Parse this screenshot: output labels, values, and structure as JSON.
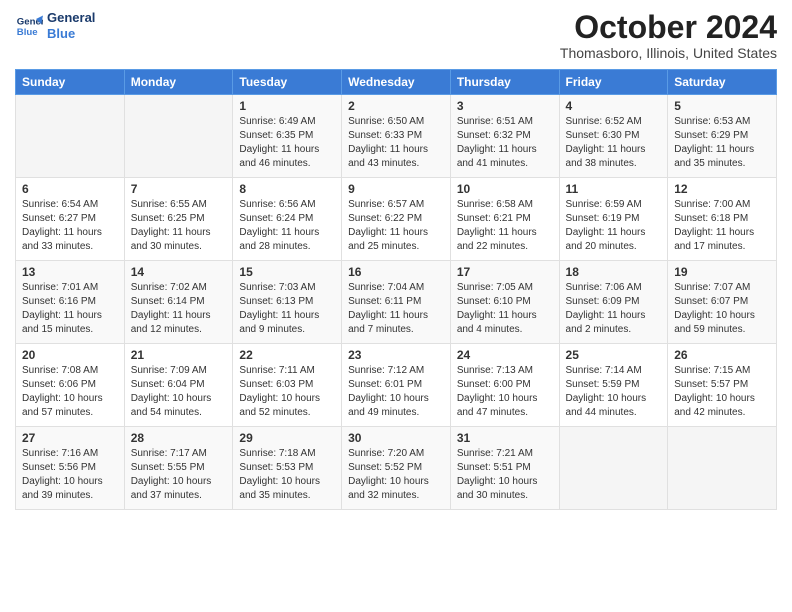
{
  "header": {
    "logo_line1": "General",
    "logo_line2": "Blue",
    "title": "October 2024",
    "location": "Thomasboro, Illinois, United States"
  },
  "days_of_week": [
    "Sunday",
    "Monday",
    "Tuesday",
    "Wednesday",
    "Thursday",
    "Friday",
    "Saturday"
  ],
  "weeks": [
    [
      {
        "day": "",
        "content": ""
      },
      {
        "day": "",
        "content": ""
      },
      {
        "day": "1",
        "content": "Sunrise: 6:49 AM\nSunset: 6:35 PM\nDaylight: 11 hours and 46 minutes."
      },
      {
        "day": "2",
        "content": "Sunrise: 6:50 AM\nSunset: 6:33 PM\nDaylight: 11 hours and 43 minutes."
      },
      {
        "day": "3",
        "content": "Sunrise: 6:51 AM\nSunset: 6:32 PM\nDaylight: 11 hours and 41 minutes."
      },
      {
        "day": "4",
        "content": "Sunrise: 6:52 AM\nSunset: 6:30 PM\nDaylight: 11 hours and 38 minutes."
      },
      {
        "day": "5",
        "content": "Sunrise: 6:53 AM\nSunset: 6:29 PM\nDaylight: 11 hours and 35 minutes."
      }
    ],
    [
      {
        "day": "6",
        "content": "Sunrise: 6:54 AM\nSunset: 6:27 PM\nDaylight: 11 hours and 33 minutes."
      },
      {
        "day": "7",
        "content": "Sunrise: 6:55 AM\nSunset: 6:25 PM\nDaylight: 11 hours and 30 minutes."
      },
      {
        "day": "8",
        "content": "Sunrise: 6:56 AM\nSunset: 6:24 PM\nDaylight: 11 hours and 28 minutes."
      },
      {
        "day": "9",
        "content": "Sunrise: 6:57 AM\nSunset: 6:22 PM\nDaylight: 11 hours and 25 minutes."
      },
      {
        "day": "10",
        "content": "Sunrise: 6:58 AM\nSunset: 6:21 PM\nDaylight: 11 hours and 22 minutes."
      },
      {
        "day": "11",
        "content": "Sunrise: 6:59 AM\nSunset: 6:19 PM\nDaylight: 11 hours and 20 minutes."
      },
      {
        "day": "12",
        "content": "Sunrise: 7:00 AM\nSunset: 6:18 PM\nDaylight: 11 hours and 17 minutes."
      }
    ],
    [
      {
        "day": "13",
        "content": "Sunrise: 7:01 AM\nSunset: 6:16 PM\nDaylight: 11 hours and 15 minutes."
      },
      {
        "day": "14",
        "content": "Sunrise: 7:02 AM\nSunset: 6:14 PM\nDaylight: 11 hours and 12 minutes."
      },
      {
        "day": "15",
        "content": "Sunrise: 7:03 AM\nSunset: 6:13 PM\nDaylight: 11 hours and 9 minutes."
      },
      {
        "day": "16",
        "content": "Sunrise: 7:04 AM\nSunset: 6:11 PM\nDaylight: 11 hours and 7 minutes."
      },
      {
        "day": "17",
        "content": "Sunrise: 7:05 AM\nSunset: 6:10 PM\nDaylight: 11 hours and 4 minutes."
      },
      {
        "day": "18",
        "content": "Sunrise: 7:06 AM\nSunset: 6:09 PM\nDaylight: 11 hours and 2 minutes."
      },
      {
        "day": "19",
        "content": "Sunrise: 7:07 AM\nSunset: 6:07 PM\nDaylight: 10 hours and 59 minutes."
      }
    ],
    [
      {
        "day": "20",
        "content": "Sunrise: 7:08 AM\nSunset: 6:06 PM\nDaylight: 10 hours and 57 minutes."
      },
      {
        "day": "21",
        "content": "Sunrise: 7:09 AM\nSunset: 6:04 PM\nDaylight: 10 hours and 54 minutes."
      },
      {
        "day": "22",
        "content": "Sunrise: 7:11 AM\nSunset: 6:03 PM\nDaylight: 10 hours and 52 minutes."
      },
      {
        "day": "23",
        "content": "Sunrise: 7:12 AM\nSunset: 6:01 PM\nDaylight: 10 hours and 49 minutes."
      },
      {
        "day": "24",
        "content": "Sunrise: 7:13 AM\nSunset: 6:00 PM\nDaylight: 10 hours and 47 minutes."
      },
      {
        "day": "25",
        "content": "Sunrise: 7:14 AM\nSunset: 5:59 PM\nDaylight: 10 hours and 44 minutes."
      },
      {
        "day": "26",
        "content": "Sunrise: 7:15 AM\nSunset: 5:57 PM\nDaylight: 10 hours and 42 minutes."
      }
    ],
    [
      {
        "day": "27",
        "content": "Sunrise: 7:16 AM\nSunset: 5:56 PM\nDaylight: 10 hours and 39 minutes."
      },
      {
        "day": "28",
        "content": "Sunrise: 7:17 AM\nSunset: 5:55 PM\nDaylight: 10 hours and 37 minutes."
      },
      {
        "day": "29",
        "content": "Sunrise: 7:18 AM\nSunset: 5:53 PM\nDaylight: 10 hours and 35 minutes."
      },
      {
        "day": "30",
        "content": "Sunrise: 7:20 AM\nSunset: 5:52 PM\nDaylight: 10 hours and 32 minutes."
      },
      {
        "day": "31",
        "content": "Sunrise: 7:21 AM\nSunset: 5:51 PM\nDaylight: 10 hours and 30 minutes."
      },
      {
        "day": "",
        "content": ""
      },
      {
        "day": "",
        "content": ""
      }
    ]
  ]
}
